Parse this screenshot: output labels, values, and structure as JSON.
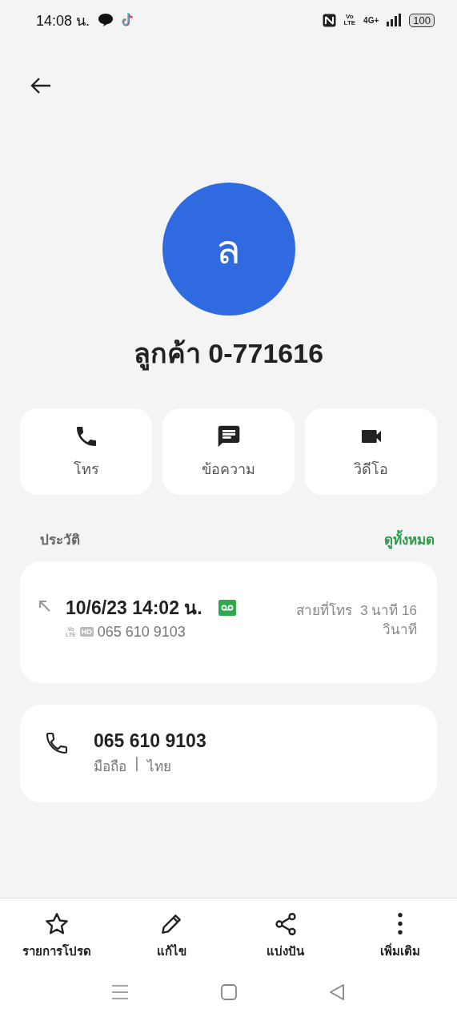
{
  "status_bar": {
    "time": "14:08 น.",
    "volte_top": "Vo",
    "volte_bottom": "LTE",
    "network": "4G+",
    "battery": "100"
  },
  "contact": {
    "initial": "ล",
    "name": "ลูกค้า 0-771616"
  },
  "actions": [
    {
      "kind": "call",
      "label": "โทร"
    },
    {
      "kind": "message",
      "label": "ข้อความ"
    },
    {
      "kind": "video",
      "label": "วิดีโอ"
    }
  ],
  "history": {
    "title": "ประวัติ",
    "see_all": "ดูทั้งหมด",
    "entries": [
      {
        "datetime": "10/6/23 14:02 น.",
        "volte_top": "Vo",
        "volte_bottom": "LTE",
        "hd": "HD",
        "number": "065 610 9103",
        "type": "สายที่โทร",
        "duration": "3 นาที 16 วินาที"
      }
    ]
  },
  "phone": {
    "number": "065 610 9103",
    "type": "มือถือ",
    "separator": "|",
    "region": "ไทย"
  },
  "bottom_bar": [
    {
      "kind": "star",
      "label": "รายการโปรด"
    },
    {
      "kind": "edit",
      "label": "แก้ไข"
    },
    {
      "kind": "share",
      "label": "แบ่งปัน"
    },
    {
      "kind": "more",
      "label": "เพิ่มเติม"
    }
  ]
}
